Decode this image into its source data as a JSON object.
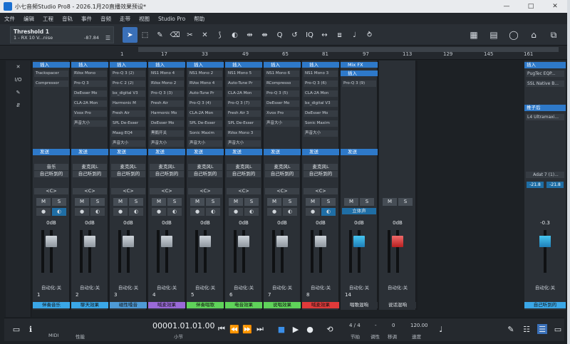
{
  "window": {
    "title": "小七音频Studio Pro8 - 2026.1月20直播效果预设*",
    "controls": [
      "—",
      "□",
      "✕"
    ]
  },
  "menu": [
    "文件",
    "编辑",
    "工程",
    "音轨",
    "事件",
    "音频",
    "走带",
    "视图",
    "Studio Pro",
    "帮助"
  ],
  "track_info": {
    "name": "Threshold 1",
    "sub": "1 - RX 10 V...nise",
    "value": "-87.84"
  },
  "ruler_ticks": [
    "1",
    "17",
    "33",
    "49",
    "65",
    "81",
    "97",
    "113",
    "129",
    "145",
    "161"
  ],
  "sidebar": [
    "I/O",
    "✎",
    "⇵"
  ],
  "strip_common": {
    "insert_label": "插入",
    "send_label": "发送",
    "route": "自己听到的",
    "pan": "<C>",
    "mute": "M",
    "solo": "S",
    "db": "0dB",
    "auto": "自动化:关"
  },
  "strips": [
    {
      "num": "1",
      "input": "音乐",
      "name": "伴奏音乐",
      "color": "#3aa7e8",
      "inserts": [
        "Trackspacer",
        "Compressor"
      ]
    },
    {
      "num": "2",
      "input": "麦克风L",
      "name": "聊天效果",
      "color": "#3aa7e8",
      "inserts": [
        "RVox Mono",
        "Pro-Q 3",
        "DeEsser Mo",
        "CLA-2A Mon",
        "Vxox Pro",
        "声音大小"
      ]
    },
    {
      "num": "3",
      "input": "麦克风L",
      "name": "磁性嗓音",
      "color": "#4e9ad6",
      "inserts": [
        "Pro-Q 3 (2)",
        "Pro-C 2 (2)",
        "bx_digital V3",
        "Harmonic M",
        "Fresh Air",
        "SPL De-Esser",
        "Maag EQ4",
        "声音大小"
      ]
    },
    {
      "num": "4",
      "input": "麦克风L",
      "name": "喊麦效果",
      "color": "#9a6ad8",
      "inserts": [
        "NS1 Mono 4",
        "RVox Mono 2",
        "Pro-Q 3 (3)",
        "Fresh Air",
        "Harmonic Mo",
        "DeEsser Mo",
        "黑鹅开关",
        "声音大小"
      ]
    },
    {
      "num": "5",
      "input": "麦克风L",
      "name": "伴奏唱歌",
      "color": "#5fd35a",
      "inserts": [
        "NS1 Mono 2",
        "RVox Mono 4",
        "Auto-Tune Pr",
        "Pro-Q 3 (4)",
        "CLA-2A Mon",
        "SPL De-Esser",
        "Sonic Maxim",
        "声音大小"
      ]
    },
    {
      "num": "6",
      "input": "麦克风L",
      "name": "电音效果",
      "color": "#5fd35a",
      "inserts": [
        "NS1 Mono 5",
        "Auto-Tune Pr",
        "CLA-2A Mon",
        "Pro-Q 3 (7)",
        "Fresh Air 3",
        "SPL De-Esser",
        "RVox Mono 3",
        "声音大小"
      ]
    },
    {
      "num": "7",
      "input": "麦克风L",
      "name": "说唱效果",
      "color": "#5fd35a",
      "inserts": [
        "NS1 Mono 6",
        "RCompresso",
        "Pro-Q 3 (5)",
        "DeEsser Mo",
        "Xvox Pro",
        "声音大小"
      ]
    },
    {
      "num": "8",
      "input": "麦克风L",
      "name": "喊麦效果",
      "color": "#e03a3a",
      "inserts": [
        "NS1 Mono 3",
        "Pro-Q 3 (6)",
        "CLA-2A Mon",
        "bx_digital V3",
        "DeEsser Mo",
        "Sonic Maxim",
        "声音大小"
      ]
    },
    {
      "num": "14",
      "input": "立体声",
      "name": "唱歌混响",
      "color": "#2b3036",
      "inserts": [
        "Pro-Q 3 (9)"
      ]
    },
    {
      "num": "",
      "input": "",
      "name": "说话混响",
      "color": "#2b3036",
      "inserts": []
    }
  ],
  "mixfx": "Mix FX",
  "rightpanel": {
    "insert_label": "插入",
    "inserts": [
      "PugTec EQP...",
      "SSL Native B..."
    ],
    "post_label": "推子后",
    "post_inserts": [
      "L4 Ultramaxi..."
    ],
    "output": "Adat 7 (1)...",
    "levels": [
      "-21.8",
      "-21.8"
    ],
    "db": "-0.3",
    "auto": "自动化:关",
    "name": "自己听到的"
  },
  "transport": {
    "midi": "MIDI",
    "perf": "性能",
    "time": "00001.01.01.00",
    "time_unit": "小节",
    "signature": "4 / 4",
    "sig_label": "节拍",
    "key": "-",
    "key_label": "调性",
    "shift": "0",
    "shift_label": "移调",
    "tempo": "120.00",
    "tempo_label": "速度"
  },
  "colors": {
    "accent": "#2e79c9",
    "bg": "#1d2125"
  }
}
